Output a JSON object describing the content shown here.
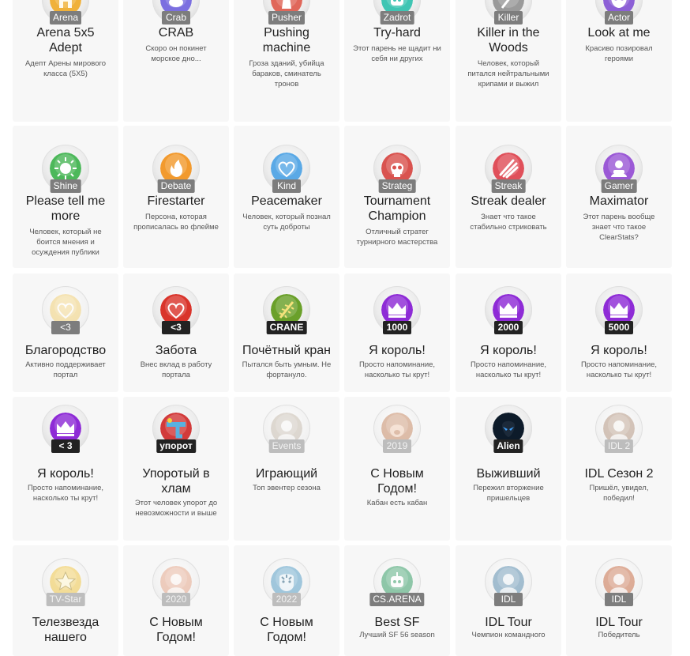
{
  "achievements": [
    {
      "label": "Arena",
      "title": "Arena 5x5\nAdept",
      "desc": "Адепт Арены мирового класса (5X5)",
      "icon": "arena-helmet-icon",
      "color": "#f0b13a",
      "glyph": "helmet"
    },
    {
      "label": "Crab",
      "title": "CRAB",
      "desc": "Скоро он покинет морское дно...",
      "icon": "crab-icon",
      "color": "#7b6fe0",
      "glyph": "crab"
    },
    {
      "label": "Pusher",
      "title": "Pushing\nmachine",
      "desc": "Гроза зданий, убийца бараков, сминатель тронов",
      "icon": "tower-icon",
      "color": "#e0675a",
      "glyph": "tower"
    },
    {
      "label": "Zadrot",
      "title": "Try-hard",
      "desc": "Этот парень не щадит ни себя ни других",
      "icon": "robot-icon",
      "color": "#3fc5b3",
      "glyph": "robot"
    },
    {
      "label": "Killer",
      "title": "Killer in the\nWoods",
      "desc": "Человек, который питался нейтральными крипами и выжил",
      "icon": "axe-icon",
      "color": "#9a9a9a",
      "glyph": "axe"
    },
    {
      "label": "Actor",
      "title": "Look at me",
      "desc": "Красиво позировал героями",
      "icon": "mask-icon",
      "color": "#8c5fd6",
      "glyph": "mask"
    },
    {
      "label": "Shine",
      "title": "Please tell me\nmore",
      "desc": "Человек, который не боится мнения и осуждения публики",
      "icon": "sun-icon",
      "color": "#4cb85a",
      "glyph": "sun"
    },
    {
      "label": "Debate",
      "title": "Firestarter",
      "desc": "Персона, которая прописалась во флейме",
      "icon": "fire-face-icon",
      "color": "#f29a2e",
      "glyph": "fire"
    },
    {
      "label": "Kind",
      "title": "Peacemaker",
      "desc": "Человек, который познал суть доброты",
      "icon": "heart-hands-icon",
      "color": "#5aa9e6",
      "glyph": "heart"
    },
    {
      "label": "Strateg",
      "title": "Tournament\nChampion",
      "desc": "Отличный стратег турнирного мастерства",
      "icon": "skull-icon",
      "color": "#d9534f",
      "glyph": "skull"
    },
    {
      "label": "Streak",
      "title": "Streak dealer",
      "desc": "Знает что такое стабильно стриковать",
      "icon": "claw-icon",
      "color": "#e0505a",
      "glyph": "claw"
    },
    {
      "label": "Gamer",
      "title": "Maximator",
      "desc": "Этот парень вообще знает что такое ClearStats?",
      "icon": "gamer-icon",
      "color": "#9b59d6",
      "glyph": "gamer"
    },
    {
      "label": "<3",
      "title": "Благородство",
      "desc": "Активно поддерживает портал",
      "icon": "heart-icon",
      "color": "#f3d27a",
      "glyph": "heart2",
      "dark": true,
      "faded": true
    },
    {
      "label": "<3",
      "title": "Забота",
      "desc": "Внес вклад в работу портала",
      "icon": "heart-icon",
      "color": "#d9342b",
      "glyph": "heart2",
      "dark": true
    },
    {
      "label": "CRANE",
      "title": "Почётный кран",
      "desc": "Пытался быть умным. Не фортануло.",
      "icon": "crane-icon",
      "color": "#6aa02a",
      "glyph": "crane",
      "dark": true
    },
    {
      "label": "1000",
      "title": "Я король!",
      "desc": "Просто напоминание, насколько ты крут!",
      "icon": "crown-icon",
      "color": "#8e2bd6",
      "glyph": "crown",
      "dark": true
    },
    {
      "label": "2000",
      "title": "Я король!",
      "desc": "Просто напоминание, насколько ты крут!",
      "icon": "crown-icon",
      "color": "#8e2bd6",
      "glyph": "crown",
      "dark": true
    },
    {
      "label": "5000",
      "title": "Я король!",
      "desc": "Просто напоминание, насколько ты крут!",
      "icon": "crown-icon",
      "color": "#8e2bd6",
      "glyph": "crown",
      "dark": true
    },
    {
      "label": "< 3",
      "title": "Я король!",
      "desc": "Просто напоминание, насколько ты крут!",
      "icon": "crown-icon",
      "color": "#8e2bd6",
      "glyph": "crown",
      "dark": true
    },
    {
      "label": "упорот",
      "title": "Упоротый в\nхлам",
      "desc": "Этот человек упорот до невозможности и выше",
      "icon": "unicorn-icon",
      "color": "#d23a3a",
      "glyph": "unicorn",
      "dark": true
    },
    {
      "label": "Events",
      "title": "Играющий",
      "desc": "Топ эвентер сезона",
      "icon": "hero-icon",
      "color": "#c9bfb2",
      "glyph": "hero",
      "faded": true
    },
    {
      "label": "2019",
      "title": "С Новым\nГодом!",
      "desc": "Кабан есть кабан",
      "icon": "boar-icon",
      "color": "#c98e6a",
      "glyph": "boar",
      "faded": true
    },
    {
      "label": "Alien",
      "title": "Выживший",
      "desc": "Пережил вторжение пришельцев",
      "icon": "alien-icon",
      "color": "#1e6fd0",
      "glyph": "alien",
      "dark": true
    },
    {
      "label": "IDL 2",
      "title": "IDL Сезон 2",
      "desc": "Пришёл, увидел, победил!",
      "icon": "warrior-icon",
      "color": "#b79a86",
      "glyph": "hero",
      "faded": true
    },
    {
      "label": "TV-Star",
      "title": "Телезвезда\nнашего",
      "desc": "",
      "icon": "star-icon",
      "color": "#f1c84b",
      "glyph": "star",
      "faded": true
    },
    {
      "label": "2020",
      "title": "С Новым\nГодом!",
      "desc": "",
      "icon": "santa-girl-icon",
      "color": "#e6a98e",
      "glyph": "hero",
      "faded": true
    },
    {
      "label": "2022",
      "title": "С Новым\nГодом!",
      "desc": "",
      "icon": "tiger-icon",
      "color": "#5aa0c7",
      "glyph": "tiger",
      "faded": true
    },
    {
      "label": "CS.ARENA",
      "title": "Best SF",
      "desc": "Лучший SF 56 season",
      "icon": "cs-arena-icon",
      "color": "#3aa06a",
      "glyph": "robot",
      "dark": true,
      "faded": true
    },
    {
      "label": "IDL",
      "title": "IDL Tour",
      "desc": "Чемпион командного",
      "icon": "idl-hero-icon",
      "color": "#5e8fb0",
      "glyph": "hero",
      "dark": true,
      "faded": true
    },
    {
      "label": "IDL",
      "title": "IDL Tour",
      "desc": "Победитель",
      "icon": "idl-hero-icon",
      "color": "#c9704a",
      "glyph": "hero",
      "dark": true,
      "faded": true
    }
  ]
}
